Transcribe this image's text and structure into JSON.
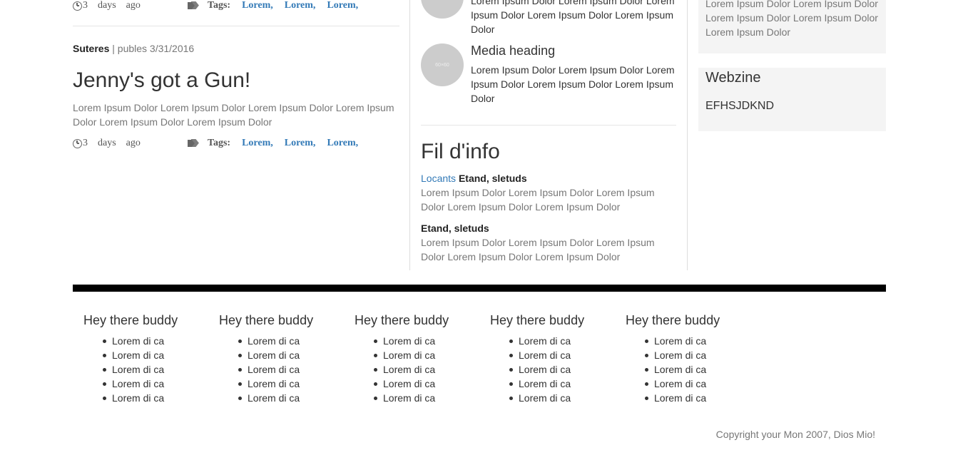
{
  "posts": [
    {
      "time_num": "3",
      "time_days": "days",
      "time_ago": "ago",
      "tags_label": "Tags:",
      "tags": [
        "Lorem,",
        "Lorem,",
        "Lorem,"
      ]
    },
    {
      "author": "Suteres",
      "published": "| publes 3/31/2016",
      "title": "Jenny's got a Gun!",
      "excerpt": "Lorem Ipsum Dolor Lorem Ipsum Dolor Lorem Ipsum Dolor Lorem Ipsum Dolor Lorem Ipsum Dolor Lorem Ipsum Dolor",
      "time_num": "3",
      "time_days": "days",
      "time_ago": "ago",
      "tags_label": "Tags:",
      "tags": [
        "Lorem,",
        "Lorem,",
        "Lorem,"
      ]
    }
  ],
  "media": [
    {
      "text": "Lorem Ipsum Dolor Lorem Ipsum Dolor Lorem Ipsum Dolor Lorem Ipsum Dolor Lorem Ipsum Dolor"
    },
    {
      "avatar_label": "60×60",
      "heading": "Media heading",
      "text": "Lorem Ipsum Dolor Lorem Ipsum Dolor Lorem Ipsum Dolor Lorem Ipsum Dolor Lorem Ipsum Dolor"
    }
  ],
  "fil_info": {
    "title": "Fil d'info",
    "items": [
      {
        "source": "Locants",
        "title": "Etand, sletuds",
        "text": "Lorem Ipsum Dolor Lorem Ipsum Dolor Lorem Ipsum Dolor Lorem Ipsum Dolor Lorem Ipsum Dolor"
      },
      {
        "title": "Etand, sletuds",
        "text": "Lorem Ipsum Dolor Lorem Ipsum Dolor Lorem Ipsum Dolor Lorem Ipsum Dolor Lorem Ipsum Dolor"
      }
    ]
  },
  "sidebar": {
    "top_text": "Lorem Ipsum Dolor Lorem Ipsum Dolor Lorem Ipsum Dolor Lorem Ipsum Dolor Lorem Ipsum Dolor",
    "webzine_title": "Webzine",
    "webzine_value": "EFHSJDKND"
  },
  "footer": {
    "columns": [
      {
        "heading": "Hey there buddy",
        "items": [
          "Lorem di ca",
          "Lorem di ca",
          "Lorem di ca",
          "Lorem di ca",
          "Lorem di ca"
        ]
      },
      {
        "heading": "Hey there buddy",
        "items": [
          "Lorem di ca",
          "Lorem di ca",
          "Lorem di ca",
          "Lorem di ca",
          "Lorem di ca"
        ]
      },
      {
        "heading": "Hey there buddy",
        "items": [
          "Lorem di ca",
          "Lorem di ca",
          "Lorem di ca",
          "Lorem di ca",
          "Lorem di ca"
        ]
      },
      {
        "heading": "Hey there buddy",
        "items": [
          "Lorem di ca",
          "Lorem di ca",
          "Lorem di ca",
          "Lorem di ca",
          "Lorem di ca"
        ]
      },
      {
        "heading": "Hey there buddy",
        "items": [
          "Lorem di ca",
          "Lorem di ca",
          "Lorem di ca",
          "Lorem di ca",
          "Lorem di ca"
        ]
      }
    ],
    "copyright": "Copyright your Mon 2007, Dios Mio!"
  }
}
